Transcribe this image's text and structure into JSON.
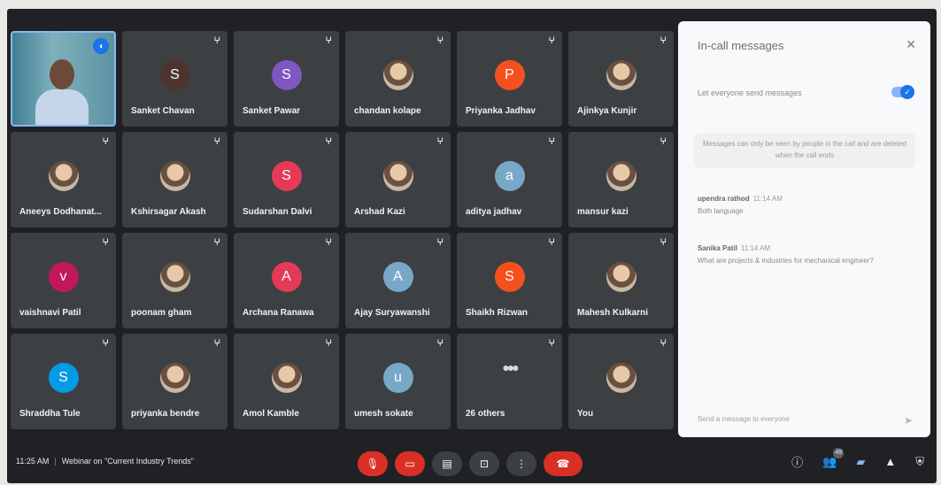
{
  "participants": [
    {
      "name": "",
      "type": "self"
    },
    {
      "name": "Sanket Chavan",
      "initial": "S",
      "color": "#4e342e",
      "type": "initial"
    },
    {
      "name": "Sanket Pawar",
      "initial": "S",
      "color": "#7e57c2",
      "type": "initial"
    },
    {
      "name": "chandan kolape",
      "type": "photo"
    },
    {
      "name": "Priyanka Jadhav",
      "initial": "P",
      "color": "#f4511e",
      "type": "initial"
    },
    {
      "name": "Ajinkya Kunjir",
      "type": "photo"
    },
    {
      "name": "Aneeys Dodhanat...",
      "type": "photo"
    },
    {
      "name": "Kshirsagar Akash",
      "type": "photo"
    },
    {
      "name": "Sudarshan Dalvi",
      "initial": "S",
      "color": "#e53958",
      "type": "initial"
    },
    {
      "name": "Arshad Kazi",
      "type": "photo"
    },
    {
      "name": "aditya jadhav",
      "initial": "a",
      "color": "#78a8c8",
      "type": "initial"
    },
    {
      "name": "mansur kazi",
      "type": "photo"
    },
    {
      "name": "vaishnavi Patil",
      "initial": "v",
      "color": "#c2185b",
      "type": "initial"
    },
    {
      "name": "poonam gham",
      "type": "photo"
    },
    {
      "name": "Archana Ranawa",
      "initial": "A",
      "color": "#e53958",
      "type": "initial"
    },
    {
      "name": "Ajay Suryawanshi",
      "initial": "A",
      "color": "#78a8c8",
      "type": "initial"
    },
    {
      "name": "Shaikh Rizwan",
      "initial": "S",
      "color": "#f4511e",
      "type": "initial"
    },
    {
      "name": "Mahesh Kulkarni",
      "type": "photo"
    },
    {
      "name": "Shraddha Tule",
      "initial": "S",
      "color": "#039be5",
      "type": "initial"
    },
    {
      "name": "priyanka bendre",
      "type": "photo"
    },
    {
      "name": "Amol Kamble",
      "type": "photo"
    },
    {
      "name": "umesh sokate",
      "initial": "u",
      "color": "#78a8c8",
      "type": "initial"
    },
    {
      "name": "26 others",
      "type": "others"
    },
    {
      "name": "You",
      "type": "photo"
    }
  ],
  "panel": {
    "title": "In-call messages",
    "toggle_label": "Let everyone send messages",
    "notice": "Messages can only be seen by people in the call and are deleted when the call ends",
    "messages": [
      {
        "sender": "upendra rathod",
        "time": "11:14 AM",
        "text": "Both language"
      },
      {
        "sender": "Sanika Patil",
        "time": "11:14 AM",
        "text": "What are projects & industries for mechanical engineer?"
      }
    ],
    "input_placeholder": "Send a message to everyone"
  },
  "bottom": {
    "time": "11:25 AM",
    "meeting_title": "Webinar on \"Current Industry Trends\"",
    "people_count": "49"
  },
  "colors": {
    "background": "#202124",
    "tile": "#3c4043",
    "end_call": "#d93025",
    "accent": "#1a73e8"
  },
  "icons": {
    "mic_muted": "mic-off-icon",
    "camera_off": "camera-off-icon",
    "captions": "captions-icon",
    "present": "present-icon",
    "more": "more-options-icon",
    "end": "end-call-icon",
    "info": "info-icon",
    "people": "people-icon",
    "chat": "chat-icon",
    "activities": "activities-icon",
    "security": "shield-icon"
  }
}
